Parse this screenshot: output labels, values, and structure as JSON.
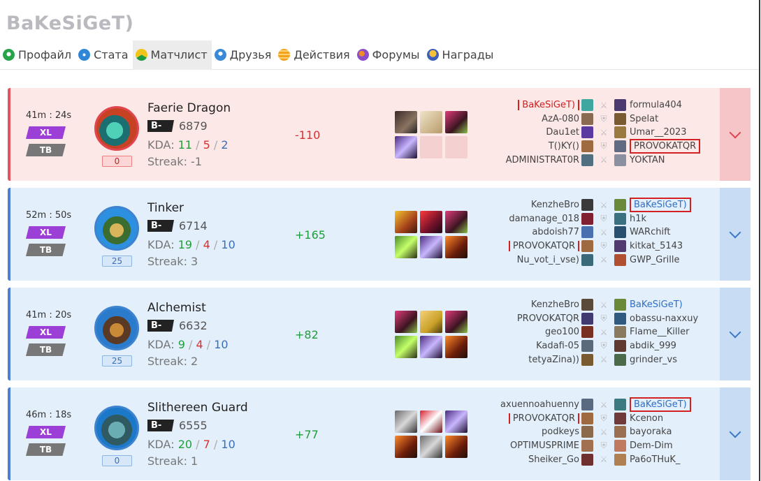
{
  "profile": {
    "name": "BaKeSiGeT)"
  },
  "tabs": [
    {
      "label": "Профайл",
      "icon": "profile-icon"
    },
    {
      "label": "Стата",
      "icon": "stats-icon"
    },
    {
      "label": "Матчлист",
      "icon": "matches-icon",
      "active": true
    },
    {
      "label": "Друзья",
      "icon": "friends-icon"
    },
    {
      "label": "Действия",
      "icon": "actions-icon"
    },
    {
      "label": "Форумы",
      "icon": "forums-icon"
    },
    {
      "label": "Награды",
      "icon": "awards-icon"
    }
  ],
  "colors": {
    "loss": "#e05561",
    "win": "#4b7fd1",
    "kills": "#1f9e3a",
    "deaths": "#d93030",
    "assists": "#3a6fb5"
  },
  "matches": [
    {
      "result": "loss",
      "duration": "41m : 24s",
      "badges": [
        "XL",
        "TB"
      ],
      "hero": "Faerie Dragon",
      "level": "0",
      "rank": "B-",
      "mmr": "6879",
      "kda_label": "KDA:",
      "kills": "11",
      "deaths": "5",
      "assists": "2",
      "streak": "Streak: -1",
      "mmr_delta": "-110",
      "radiant": [
        "BaKeSiGeT)",
        "AzA-080",
        "Dau1et",
        "T()KY()",
        "ADMINISTRAT0R"
      ],
      "dire": [
        "formula404",
        "Spelat",
        "Umar__2023",
        "PROVOKATQR",
        "YOKTAN"
      ]
    },
    {
      "result": "win",
      "duration": "52m : 50s",
      "badges": [
        "XL",
        "TB"
      ],
      "hero": "Tinker",
      "level": "25",
      "rank": "B-",
      "mmr": "6714",
      "kda_label": "KDA:",
      "kills": "19",
      "deaths": "4",
      "assists": "10",
      "streak": "Streak: 3",
      "mmr_delta": "+165",
      "radiant": [
        "KenzheBro",
        "damanage_018",
        "abdoish77",
        "PROVOKATQR",
        "Nu_vot_i_vse)"
      ],
      "dire": [
        "BaKeSiGeT)",
        "h1k",
        "WARchift",
        "kitkat_5143",
        "GWP_Grille"
      ]
    },
    {
      "result": "win",
      "duration": "41m : 20s",
      "badges": [
        "XL",
        "TB"
      ],
      "hero": "Alchemist",
      "level": "25",
      "rank": "B-",
      "mmr": "6632",
      "kda_label": "KDA:",
      "kills": "9",
      "deaths": "4",
      "assists": "10",
      "streak": "Streak: 2",
      "mmr_delta": "+82",
      "radiant": [
        "KenzheBro",
        "PROVOKATQR",
        "geo100",
        "Kadafi-05",
        "tetyaZina))"
      ],
      "dire": [
        "BaKeSiGeT)",
        "obassu-naxxuy",
        "Flame__Killer",
        "abdik_999",
        "grinder_vs"
      ]
    },
    {
      "result": "win",
      "duration": "46m : 18s",
      "badges": [
        "XL",
        "TB"
      ],
      "hero": "Slithereen Guard",
      "level": "0",
      "rank": "B-",
      "mmr": "6555",
      "kda_label": "KDA:",
      "kills": "20",
      "deaths": "7",
      "assists": "10",
      "streak": "Streak: 1",
      "mmr_delta": "+77",
      "radiant": [
        "axuennoahuenny",
        "PROVOKATQR",
        "podkeys",
        "OPTIMUSPRIME",
        "Sheiker_Go"
      ],
      "dire": [
        "BaKeSiGeT)",
        "Kcenon",
        "bayoraka",
        "Dem-Dim",
        "Pa6oTHuK_"
      ]
    }
  ]
}
